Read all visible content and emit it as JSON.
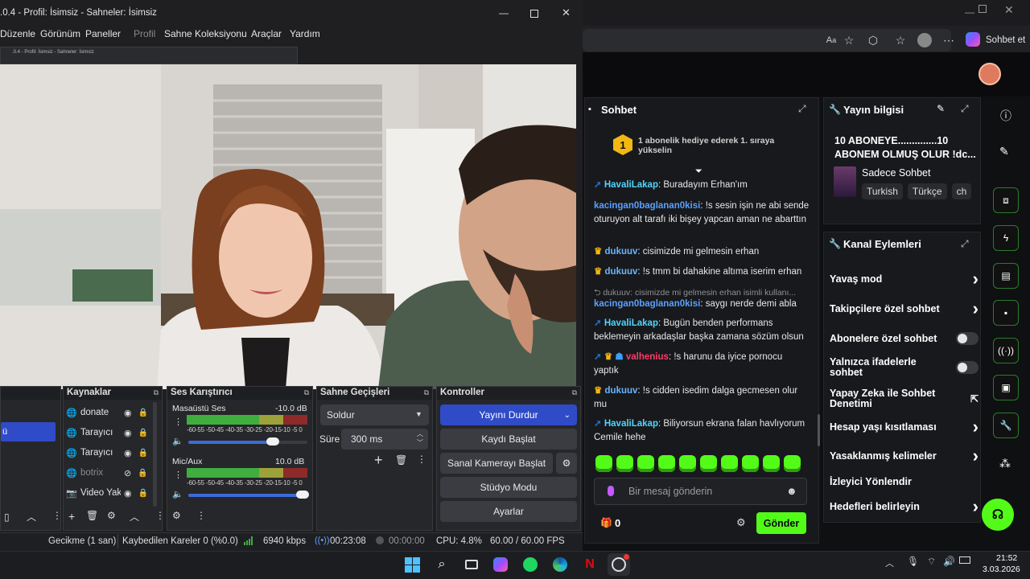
{
  "obs": {
    "title": ".0.4 - Profil: İsimsiz - Sahneler: İsimsiz",
    "menu": [
      "Düzenle",
      "Görünüm",
      "Paneller",
      "Profil",
      "Sahne Koleksiyonu",
      "Araçlar",
      "Yardım"
    ],
    "preview_nested_title": ".0.4 - Profil: İsimsiz - Sahneler: İsimsiz",
    "docks": {
      "sources_title": "Kaynaklar",
      "mixer_title": "Ses Karıştırıcı",
      "transitions_title": "Sahne Geçişleri",
      "controls_title": "Kontroller"
    },
    "sources": [
      {
        "name": "donate",
        "icon": "globe-icon",
        "visible": true,
        "locked": true
      },
      {
        "name": "Tarayıcı",
        "icon": "globe-icon",
        "visible": true,
        "locked": true
      },
      {
        "name": "Tarayıcı",
        "icon": "globe-icon",
        "visible": true,
        "locked": true
      },
      {
        "name": "botrix",
        "icon": "globe-icon",
        "visible": false,
        "locked": true
      },
      {
        "name": "Video Yakalama",
        "icon": "camera-icon",
        "visible": true,
        "locked": true
      }
    ],
    "scene_selected": "ü",
    "mixer": [
      {
        "name": "Masaüstü Ses",
        "db": "-10.0 dB",
        "level": 0.75
      },
      {
        "name": "Mic/Aux",
        "db": "10.0 dB",
        "level": 1.0
      }
    ],
    "meter_scale": "-60-55 -50-45 -40-35 -30-25 -20-15-10 -5  0",
    "transition": {
      "type": "Soldur",
      "duration_label": "Süre",
      "duration": "300 ms"
    },
    "controls": [
      "Yayını Durdur",
      "Kaydı Başlat",
      "Sanal Kamerayı Başlat",
      "Stüdyo Modu",
      "Ayarlar"
    ],
    "status": {
      "delay": "Gecikme (1 san)",
      "dropped": "Kaybedilen Kareler 0 (%0.0)",
      "bitrate": "6940 kbps",
      "live_time": "00:23:08",
      "rec_time": "00:00:00",
      "cpu": "CPU: 4.8%",
      "fps": "60.00 / 60.00 FPS"
    }
  },
  "browser": {
    "copilot_label": "Sohbet et"
  },
  "chat": {
    "title": "Sohbet",
    "gift_banner": "1 abonelik hediye ederek 1. sıraya yükselin",
    "gift_rank": "1",
    "messages": [
      {
        "user": "HavaliLakap",
        "color": "#4fd6ff",
        "badges": [
          "verified-icon"
        ],
        "text": ": Buradayım Erhan'ım"
      },
      {
        "user": "kacingan0baglanan0kisi",
        "color": "#5aa0ff",
        "badges": [],
        "text": ": !s sesin işin ne abi sende oturuyon alt tarafı iki bişey yapcan aman ne abarttın"
      },
      {
        "user": "dukuuv",
        "color": "#6ab4ff",
        "badges": [
          "crown-icon"
        ],
        "text": ": cisimizde mi gelmesin erhan"
      },
      {
        "user": "dukuuv",
        "color": "#6ab4ff",
        "badges": [
          "crown-icon"
        ],
        "text": ": !s tmm bi dahakine altıma iserim erhan"
      },
      {
        "reply": "dukuuv: cisimizde mi gelmesin erhan isimli kullanı...",
        "user": "kacingan0baglanan0kisi",
        "color": "#5aa0ff",
        "badges": [],
        "text": ": saygı nerde demi abla"
      },
      {
        "user": "HavaliLakap",
        "color": "#4fd6ff",
        "badges": [
          "verified-icon"
        ],
        "text": ": Bugün benden performans beklemeyin arkadaşlar başka zamana sözüm olsun"
      },
      {
        "user": "valhenius",
        "color": "#ff3b6b",
        "badges": [
          "verified-icon",
          "crown-icon",
          "sub-icon"
        ],
        "text": ": !s harunu da iyice pornocu yaptık"
      },
      {
        "user": "dukuuv",
        "color": "#6ab4ff",
        "badges": [
          "crown-icon"
        ],
        "text": ": !s cidden isedim dalga gecmesen olur mu"
      },
      {
        "user": "HavaliLakap",
        "color": "#4fd6ff",
        "badges": [
          "verified-icon"
        ],
        "text": ": Biliyorsun ekrana falan havlıyorum Cemile hehe"
      }
    ],
    "input_placeholder": "Bir mesaj gönderin",
    "viewer_count": "0",
    "send_label": "Gönder"
  },
  "stream_info": {
    "title": "Yayın bilgisi",
    "stream_title": "10 ABONEYE..............10 ABONEM OLMUŞ OLUR !dc...",
    "category": "Sadece Sohbet",
    "tags": [
      "Turkish",
      "Türkçe",
      "ch"
    ]
  },
  "channel_actions": {
    "title": "Kanal Eylemleri",
    "rows": [
      {
        "label": "Yavaş mod",
        "control": "chevron"
      },
      {
        "label": "Takipçilere özel sohbet",
        "control": "chevron"
      },
      {
        "label": "Abonelere özel sohbet",
        "control": "toggle"
      },
      {
        "label": "Yalnızca ifadelerle sohbet",
        "control": "toggle"
      },
      {
        "label": "Yapay Zeka ile Sohbet Denetimi",
        "control": "external"
      },
      {
        "label": "Hesap yaşı kısıtlaması",
        "control": "chevron"
      },
      {
        "label": "Yasaklanmış kelimeler",
        "control": "chevron"
      },
      {
        "label": "İzleyici Yönlendir",
        "control": "none"
      },
      {
        "label": "Hedefleri belirleyin",
        "control": "chevron"
      }
    ]
  },
  "taskbar": {
    "time": "21:52",
    "date": "3.03.2026"
  }
}
